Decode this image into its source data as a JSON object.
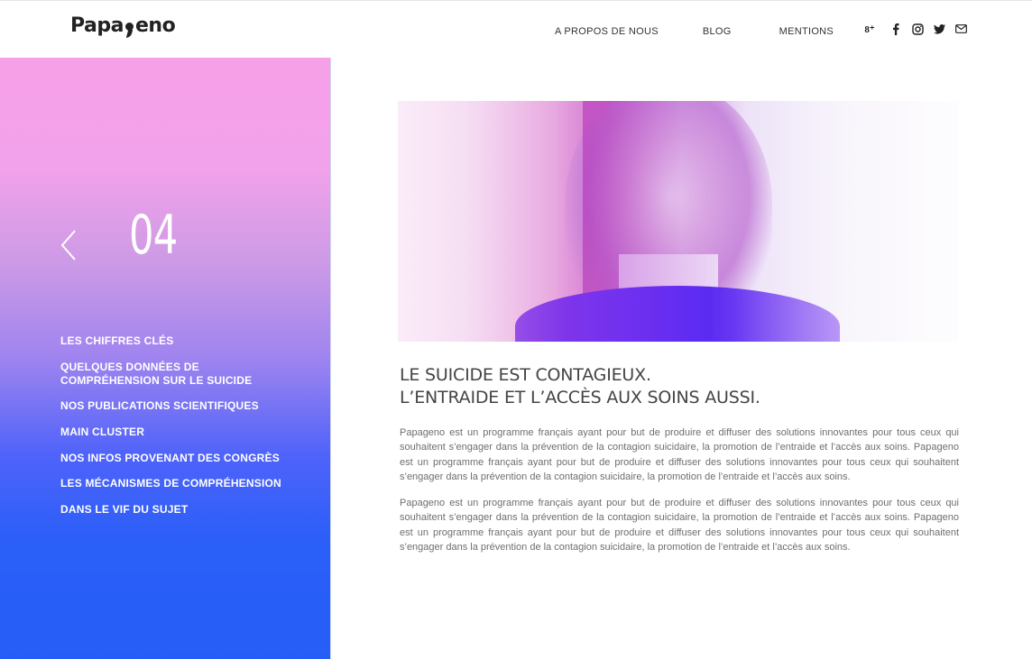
{
  "header": {
    "logo_left": "Papa",
    "logo_right": "eno",
    "nav": [
      "A PROPOS DE NOUS",
      "BLOG",
      "MENTIONS"
    ],
    "social_icons": [
      "google-plus-icon",
      "facebook-icon",
      "instagram-icon",
      "twitter-icon",
      "mail-icon"
    ],
    "gplus_glyph": "8⁺"
  },
  "sidebar": {
    "page_number": "04",
    "menu": [
      "LES CHIFFRES CLÉS",
      "QUELQUES DONNÉES DE COMPRÉHENSION SUR LE SUICIDE",
      "NOS PUBLICATIONS SCIENTIFIQUES",
      "MAIN CLUSTER",
      "NOS INFOS PROVENANT DES CONGRÈS",
      "LES MÉCANISMES DE COMPRÉHENSION",
      "DANS LE VIF DU SUJET"
    ],
    "colors": {
      "top": "#f6a0e8",
      "bottom": "#255ef7"
    }
  },
  "main": {
    "headline_line1": "LE SUICIDE EST CONTAGIEUX.",
    "headline_line2": "L’ENTRAIDE ET L’ACCÈS AUX SOINS AUSSI.",
    "paragraphs": [
      "Papageno est un programme français ayant pour but de produire et diffuser des solutions innovantes pour tous ceux qui souhaitent s’engager dans la prévention de la contagion suicidaire, la promotion de l’entraide et l’accès aux soins. Papageno est un programme français ayant pour but de produire et diffuser des solutions innovantes pour tous ceux qui souhaitent s’engager dans la prévention de la contagion suicidaire, la promotion de l’entraide et l’accès aux soins.",
      "Papageno est un programme français ayant pour but de produire et diffuser des solutions innovantes pour tous ceux qui souhaitent s’engager dans la prévention de la contagion suicidaire, la promotion de l’entraide et l’accès aux soins. Papageno est un programme français ayant pour but de produire et diffuser des solutions innovantes pour tous ceux qui souhaitent s’engager dans la prévention de la contagion suicidaire, la promotion de l’entraide et l’accès aux soins."
    ]
  }
}
